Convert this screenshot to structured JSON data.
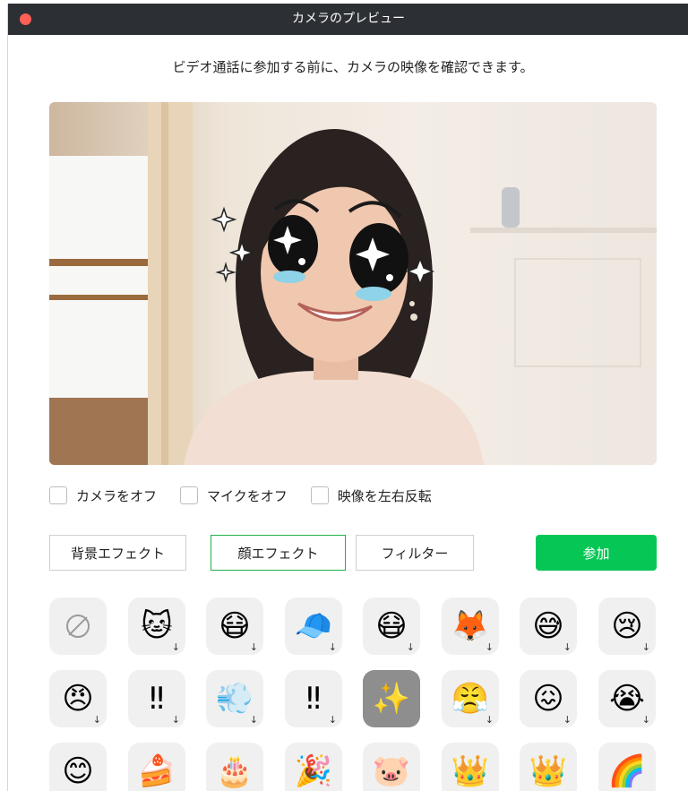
{
  "window": {
    "title": "カメラのプレビュー"
  },
  "subtitle": "ビデオ通話に参加する前に、カメラの映像を確認できます。",
  "options": [
    {
      "label": "カメラをオフ",
      "checked": false
    },
    {
      "label": "マイクをオフ",
      "checked": false
    },
    {
      "label": "映像を左右反転",
      "checked": false
    }
  ],
  "tabs": {
    "background": "背景エフェクト",
    "face": "顔エフェクト",
    "filter": "フィルター",
    "active": "face"
  },
  "join_label": "参加",
  "download_glyph": "↓",
  "effects": [
    {
      "icon": "none-icon",
      "glyph": "",
      "download": false
    },
    {
      "icon": "cat-photo-icon",
      "glyph": "🐱",
      "download": true
    },
    {
      "icon": "white-mask-face-icon",
      "glyph": "😷",
      "download": true
    },
    {
      "icon": "cap-mask-face-icon",
      "glyph": "🧢",
      "download": true
    },
    {
      "icon": "black-mask-face-icon",
      "glyph": "😷",
      "download": true
    },
    {
      "icon": "fox-mask-icon",
      "glyph": "🦊",
      "download": true
    },
    {
      "icon": "sweat-face-icon",
      "glyph": "😅",
      "download": true
    },
    {
      "icon": "sad-face-icon",
      "glyph": "😢",
      "download": true
    },
    {
      "icon": "angry-face-icon",
      "glyph": "😠",
      "download": true
    },
    {
      "icon": "exclamation-icon",
      "glyph": "‼",
      "download": true
    },
    {
      "icon": "steam-puff-icon",
      "glyph": "💨",
      "download": true
    },
    {
      "icon": "exclamation-icon",
      "glyph": "‼",
      "download": true
    },
    {
      "icon": "sparkly-eyes-icon",
      "glyph": "✨",
      "download": false
    },
    {
      "icon": "annoyed-face-icon",
      "glyph": "😤",
      "download": true
    },
    {
      "icon": "frustrated-face-icon",
      "glyph": "😖",
      "download": true
    },
    {
      "icon": "crying-face-icon",
      "glyph": "😭",
      "download": true
    },
    {
      "icon": "blush-face-icon",
      "glyph": "😊",
      "download": false
    },
    {
      "icon": "cake-roll-icon",
      "glyph": "🍰",
      "download": false
    },
    {
      "icon": "birthday-cake-icon",
      "glyph": "🎂",
      "download": false
    },
    {
      "icon": "party-hat-icon",
      "glyph": "🎉",
      "download": false
    },
    {
      "icon": "pig-face-icon",
      "glyph": "🐷",
      "download": false
    },
    {
      "icon": "crown-icon",
      "glyph": "👑",
      "download": false
    },
    {
      "icon": "tiara-icon",
      "glyph": "👑",
      "download": false
    },
    {
      "icon": "rainbow-icon",
      "glyph": "🌈",
      "download": false
    }
  ],
  "selected_effect_index": 12,
  "colors": {
    "accent": "#06c755",
    "active_tab_border": "#22b04a",
    "titlebar": "#2c2f33",
    "close_button": "#fe5f57"
  }
}
